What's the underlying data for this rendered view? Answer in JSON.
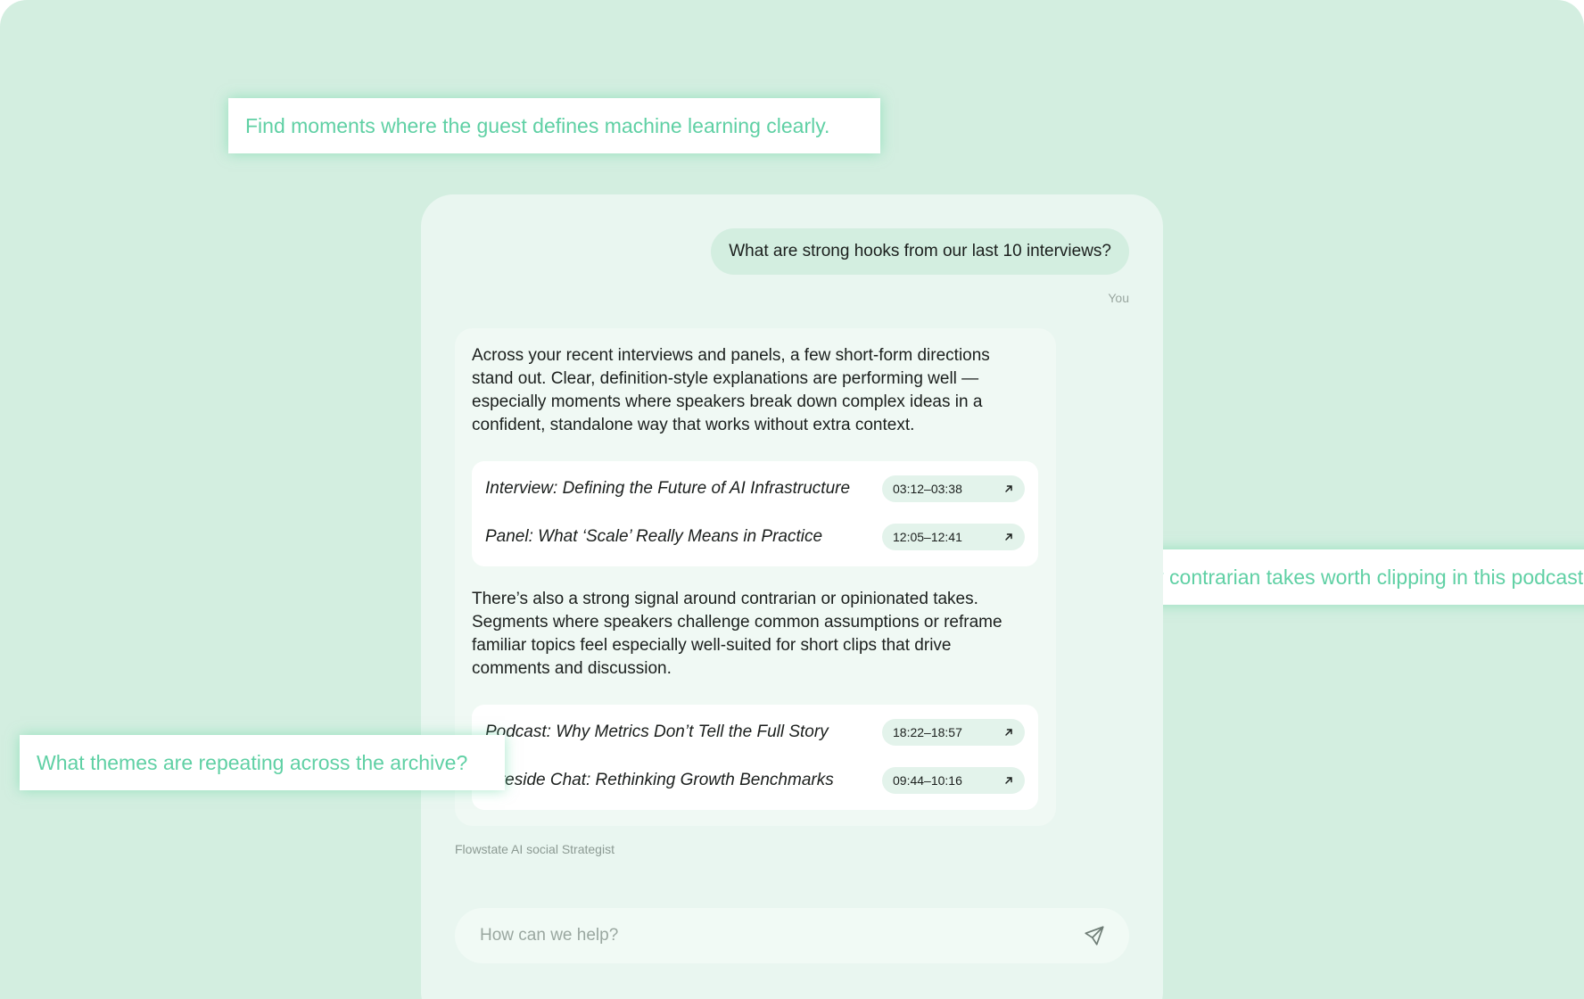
{
  "chips": [
    {
      "text": "Find moments where the guest defines machine learning clearly."
    },
    {
      "text": "Any contrarian takes worth clipping in this podcast?"
    },
    {
      "text": "What themes are repeating across the archive?"
    }
  ],
  "chat": {
    "user_message": "What are strong hooks from our last 10 interviews?",
    "user_label": "You",
    "paragraph_1": "Across your recent interviews and panels, a few short-form directions stand out. Clear, definition-style explanations are performing well — especially moments where speakers break down complex ideas in a confident, standalone way that works without extra context.",
    "refs_1": [
      {
        "title": "Interview: Defining the Future of AI Infrastructure",
        "time": "03:12–03:38",
        "icon": "arrow-up-right-icon"
      },
      {
        "title": "Panel: What ‘Scale’ Really Means in Practice",
        "time": "12:05–12:41",
        "icon": "arrow-up-right-icon"
      }
    ],
    "paragraph_2": "There’s also a strong signal around contrarian or opinionated takes. Segments where speakers challenge common assumptions or reframe familiar topics feel especially well-suited for short clips that drive comments and discussion.",
    "refs_2": [
      {
        "title": "Podcast: Why Metrics Don’t Tell the Full Story",
        "time": "18:22–18:57",
        "icon": "arrow-up-right-icon"
      },
      {
        "title": "Fireside Chat: Rethinking Growth Benchmarks",
        "time": "09:44–10:16",
        "icon": "arrow-up-right-icon"
      }
    ],
    "assistant_name": "Flowstate AI social Strategist"
  },
  "composer": {
    "placeholder": "How can we help?",
    "send_icon": "send-icon"
  },
  "colors": {
    "background": "#d3eee0",
    "panel": "#e9f6f0",
    "accent_text": "#5fd0a4"
  }
}
